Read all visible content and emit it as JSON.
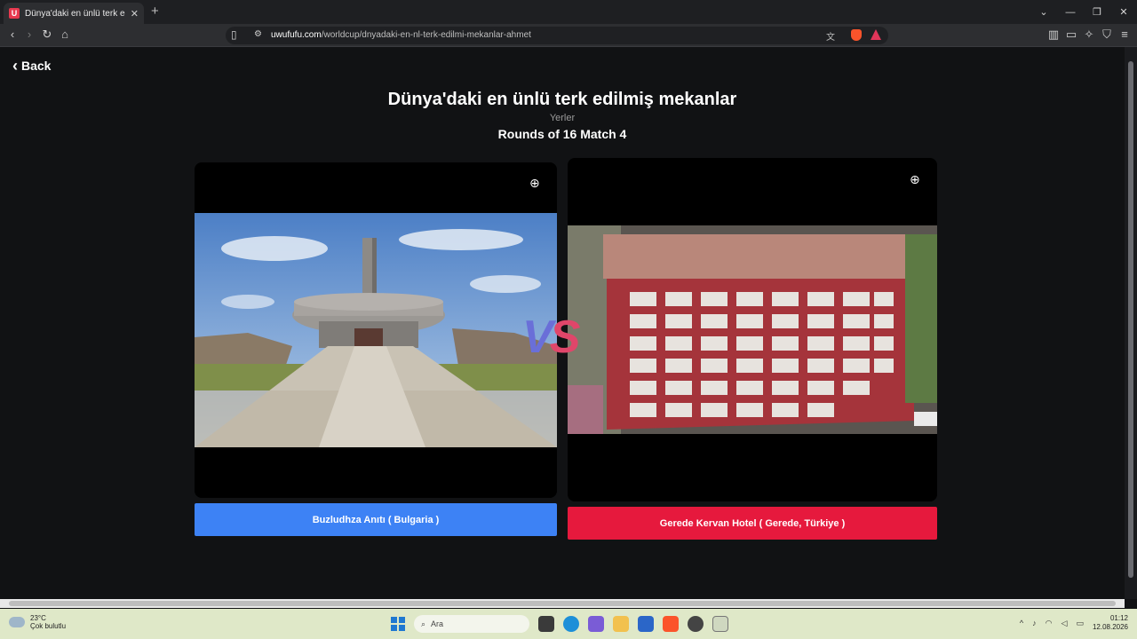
{
  "browser": {
    "tab_title": "Dünya'daki en ünlü terk edilmiş",
    "tab_favicon": "U",
    "new_tab": "+",
    "url_host": "uwufufu.com",
    "url_path": "/worldcup/dnyadaki-en-nl-terk-edilmi-mekanlar-ahmet",
    "window_controls": [
      "⌄",
      "—",
      "❐",
      "✕"
    ]
  },
  "page": {
    "back_label": "Back",
    "title": "Dünya'daki en ünlü terk edilmiş mekanlar",
    "category": "Yerler",
    "round": "Rounds of 16 Match 4",
    "vs_v": "V",
    "vs_s": "S",
    "left_choice": {
      "label": "Buzludhza Anıtı ( Bulgaria )",
      "color": "#3d82f5"
    },
    "right_choice": {
      "label": "Gerede Kervan Hotel ( Gerede, Türkiye )",
      "color": "#e6193d"
    }
  },
  "taskbar": {
    "temp": "23°C",
    "weather": "Çok bulutlu",
    "search_placeholder": "Ara",
    "time": "01:12",
    "date": "12.08.2026"
  }
}
